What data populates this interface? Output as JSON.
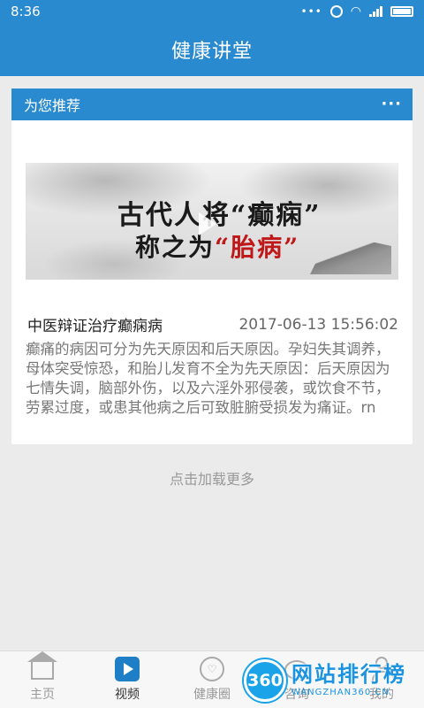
{
  "status_bar": {
    "time": "8:36",
    "icons": [
      "more-dots-icon",
      "alarm-icon",
      "wifi-icon",
      "signal-icon",
      "battery-icon"
    ]
  },
  "app_bar": {
    "title": "健康讲堂"
  },
  "recommend_card": {
    "header": "为您推荐",
    "more_label": "···",
    "thumbnail": {
      "line1_prefix": "古代人将",
      "line1_highlight": "“癫痫”",
      "line2_prefix": "称之为",
      "line2_highlight": "“胎病”"
    },
    "article": {
      "title": "中医辩证治疗癫痫病",
      "time": "2017-06-13 15:56:02",
      "summary": "癫痛的病因可分为先天原因和后天原因。孕妇失其调养，母体突受惊恐，和胎儿发育不全为先天原因：后天原因为七情失调，脑部外伤，以及六淫外邪侵袭，或饮食不节，劳累过度，或患其他病之后可致脏腑受损发为痛证。rn"
    }
  },
  "load_more": "点击加载更多",
  "bottom_nav": {
    "items": [
      {
        "label": "主页",
        "icon": "home-icon"
      },
      {
        "label": "视频",
        "icon": "video-icon"
      },
      {
        "label": "健康圈",
        "icon": "heart-circle-icon"
      },
      {
        "label": "咨询",
        "icon": "chat-icon"
      },
      {
        "label": "我的",
        "icon": "user-icon"
      }
    ],
    "active": "视频"
  },
  "watermark": {
    "badge": "360",
    "name": "网站排行榜",
    "domain": "WANGZHAN360.CN"
  },
  "colors": {
    "primary": "#2a8ad0",
    "active_bubble": "#f6cfb1",
    "background": "#ebebeb"
  }
}
